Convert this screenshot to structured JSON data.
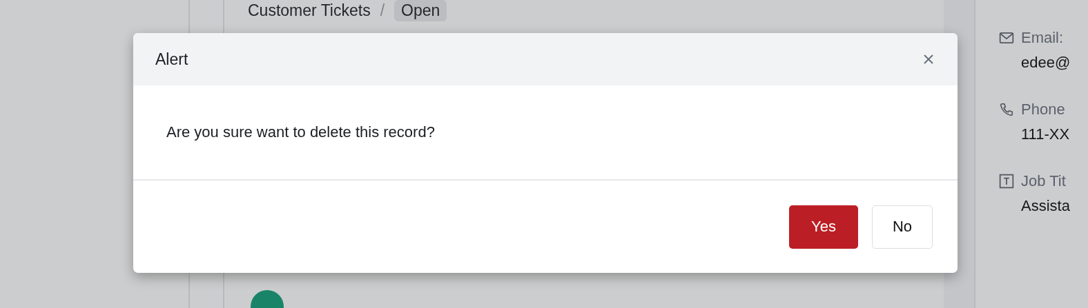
{
  "breadcrumb": {
    "parent": "Customer Tickets",
    "separator": "/",
    "current": "Open"
  },
  "contact": [
    {
      "kind": "email",
      "label": "Email:",
      "value": "edee@"
    },
    {
      "kind": "phone",
      "label": "Phone",
      "value": "111-XX"
    },
    {
      "kind": "title",
      "label": "Job Tit",
      "value": "Assista"
    }
  ],
  "dialog": {
    "title": "Alert",
    "message": "Are you sure want to delete this record?",
    "buttons": [
      {
        "label": "Yes",
        "kind": "primary"
      },
      {
        "label": "No",
        "kind": "secondary"
      }
    ]
  }
}
